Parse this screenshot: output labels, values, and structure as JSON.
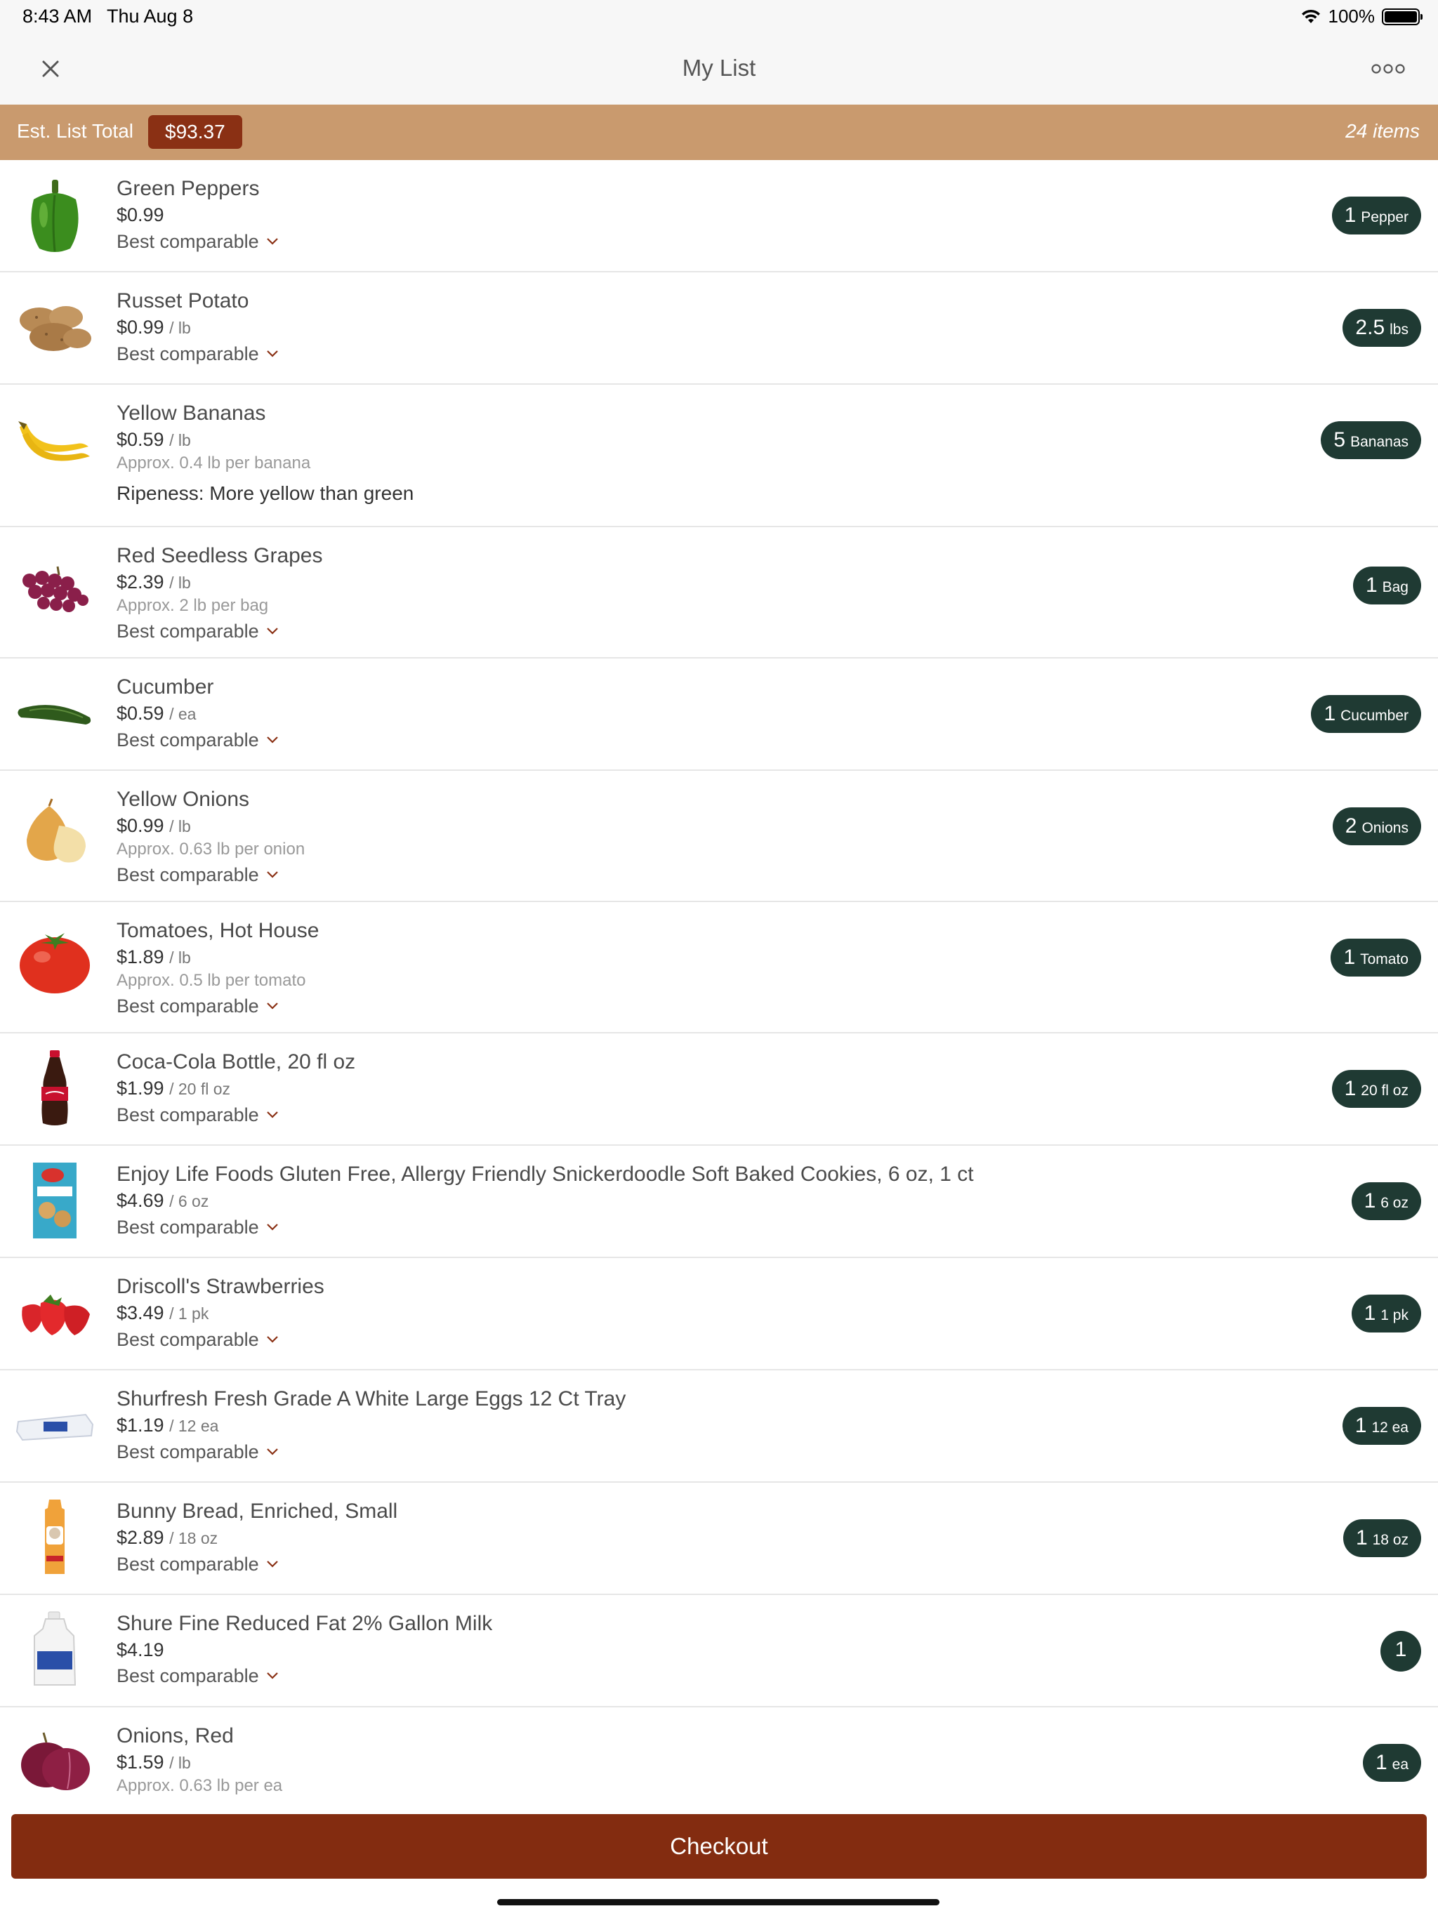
{
  "status_bar": {
    "time": "8:43 AM",
    "date": "Thu Aug 8",
    "battery": "100%"
  },
  "nav": {
    "title": "My List"
  },
  "totals": {
    "label": "Est. List Total",
    "amount": "$93.37",
    "count": "24 items"
  },
  "comparable_label": "Best comparable",
  "items": [
    {
      "name": "Green Peppers",
      "price": "$0.99",
      "unit": "",
      "approx": "",
      "comparable": "Best comparable",
      "qty": "1",
      "qty_unit": "Pepper",
      "icon": "pepper"
    },
    {
      "name": "Russet Potato",
      "price": "$0.99",
      "unit": "/ lb",
      "approx": "",
      "comparable": "Best comparable",
      "qty": "2.5",
      "qty_unit": "lbs",
      "icon": "potato"
    },
    {
      "name": "Yellow Bananas",
      "price": "$0.59",
      "unit": "/ lb",
      "approx": "Approx. 0.4 lb per banana",
      "ripeness": "Ripeness: More yellow than green",
      "qty": "5",
      "qty_unit": "Bananas",
      "icon": "banana"
    },
    {
      "name": "Red Seedless Grapes",
      "price": "$2.39",
      "unit": "/ lb",
      "approx": "Approx. 2 lb per bag",
      "comparable": "Best comparable",
      "qty": "1",
      "qty_unit": "Bag",
      "icon": "grapes"
    },
    {
      "name": "Cucumber",
      "price": "$0.59",
      "unit": "/ ea",
      "approx": "",
      "comparable": "Best comparable",
      "qty": "1",
      "qty_unit": "Cucumber",
      "icon": "cucumber"
    },
    {
      "name": "Yellow Onions",
      "price": "$0.99",
      "unit": "/ lb",
      "approx": "Approx. 0.63 lb per onion",
      "comparable": "Best comparable",
      "qty": "2",
      "qty_unit": "Onions",
      "icon": "onion"
    },
    {
      "name": "Tomatoes, Hot House",
      "price": "$1.89",
      "unit": "/ lb",
      "approx": "Approx. 0.5 lb per tomato",
      "comparable": "Best comparable",
      "qty": "1",
      "qty_unit": "Tomato",
      "icon": "tomato"
    },
    {
      "name": "Coca-Cola Bottle, 20 fl oz",
      "price": "$1.99",
      "unit": "/ 20 fl oz",
      "approx": "",
      "comparable": "Best comparable",
      "qty": "1",
      "qty_unit": "20 fl oz",
      "icon": "cola-bottle"
    },
    {
      "name": "Enjoy Life Foods Gluten Free, Allergy Friendly Snickerdoodle Soft Baked Cookies, 6 oz, 1 ct",
      "price": "$4.69",
      "unit": "/ 6 oz",
      "approx": "",
      "comparable": "Best comparable",
      "qty": "1",
      "qty_unit": "6 oz",
      "icon": "cookie-box"
    },
    {
      "name": "Driscoll's Strawberries",
      "price": "$3.49",
      "unit": "/ 1 pk",
      "approx": "",
      "comparable": "Best comparable",
      "qty": "1",
      "qty_unit": "1 pk",
      "icon": "strawberry"
    },
    {
      "name": "Shurfresh Fresh Grade A White Large Eggs 12 Ct Tray",
      "price": "$1.19",
      "unit": "/ 12 ea",
      "approx": "",
      "comparable": "Best comparable",
      "qty": "1",
      "qty_unit": "12 ea",
      "icon": "eggs"
    },
    {
      "name": "Bunny Bread, Enriched, Small",
      "price": "$2.89",
      "unit": "/ 18 oz",
      "approx": "",
      "comparable": "Best comparable",
      "qty": "1",
      "qty_unit": "18 oz",
      "icon": "bread"
    },
    {
      "name": "Shure Fine Reduced Fat 2% Gallon Milk",
      "price": "$4.19",
      "unit": "",
      "approx": "",
      "comparable": "Best comparable",
      "qty": "1",
      "qty_unit": "",
      "icon": "milk-jug"
    },
    {
      "name": "Onions, Red",
      "price": "$1.59",
      "unit": "/ lb",
      "approx": "Approx. 0.63 lb per ea",
      "comparable": "",
      "qty": "1",
      "qty_unit": "ea",
      "icon": "red-onion"
    }
  ],
  "checkout": {
    "label": "Checkout"
  },
  "colors": {
    "totals_bar": "#c99a6e",
    "total_badge": "#8a3014",
    "qty_pill": "#1f3a33",
    "checkout": "#832c10"
  }
}
